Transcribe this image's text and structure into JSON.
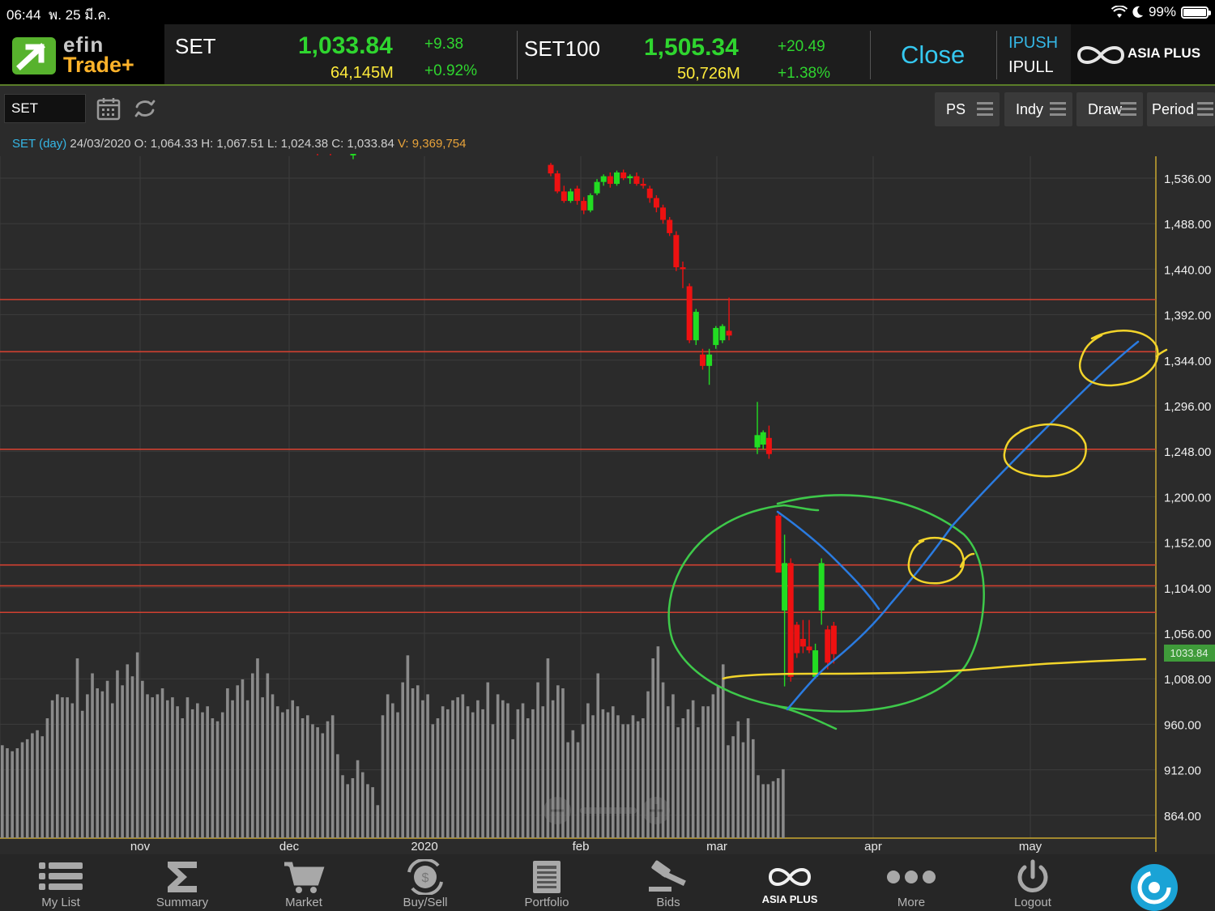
{
  "status": {
    "time": "06:44",
    "date": "พ. 25 มี.ค.",
    "battery": "99%"
  },
  "brand": {
    "line1": "efin",
    "line2": "Trade+"
  },
  "indices": [
    {
      "name": "SET",
      "value": "1,033.84",
      "change": "+9.38",
      "volume": "64,145M",
      "percent": "+0.92%"
    },
    {
      "name": "SET100",
      "value": "1,505.34",
      "change": "+20.49",
      "volume": "50,726M",
      "percent": "+1.38%"
    }
  ],
  "market_status": "Close",
  "push": "PUSH",
  "pull": "PULL",
  "broker": "ASIA PLUS",
  "toolbar": {
    "symbol": "SET",
    "buttons": [
      "PS",
      "Indy",
      "Draw",
      "Period"
    ]
  },
  "ohlc": {
    "symbol": "SET (day)",
    "date": "24/03/2020",
    "o_label": "O:",
    "o": "1,064.33",
    "h_label": "H:",
    "h": "1,067.51",
    "l_label": "L:",
    "l": "1,024.38",
    "c_label": "C:",
    "c": "1,033.84",
    "v_label": "V:",
    "v": "9,369,754"
  },
  "colors": {
    "up": "#22dd22",
    "down": "#ee1111",
    "accent": "#35c8f0",
    "volume": "#8a8a8a",
    "hline": "#d04030"
  },
  "chart_data": {
    "type": "candlestick",
    "ylim": [
      840,
      1560
    ],
    "y_ticks": [
      "1,536.00",
      "1,488.00",
      "1,440.00",
      "1,392.00",
      "1,344.00",
      "1,296.00",
      "1,248.00",
      "1,200.00",
      "1,152.00",
      "1,104.00",
      "1,056.00",
      "1,008.00",
      "960.00",
      "912.00",
      "864.00"
    ],
    "x_ticks": [
      "nov",
      "dec",
      "2020",
      "feb",
      "mar",
      "apr",
      "may"
    ],
    "last_price_label": "1033.84",
    "horizontal_levels": [
      1408,
      1353,
      1250,
      1128,
      1106,
      1078
    ],
    "candles": [
      [
        1582,
        1585,
        1566,
        1572
      ],
      [
        1570,
        1576,
        1560,
        1565
      ],
      [
        1568,
        1580,
        1564,
        1578
      ],
      [
        1575,
        1577,
        1560,
        1562
      ],
      [
        1560,
        1578,
        1556,
        1575
      ],
      [
        1575,
        1579,
        1568,
        1577
      ],
      [
        1550,
        1552,
        1538,
        1541
      ],
      [
        1541,
        1544,
        1520,
        1522
      ],
      [
        1522,
        1528,
        1510,
        1512
      ],
      [
        1512,
        1525,
        1510,
        1522
      ],
      [
        1525,
        1528,
        1508,
        1512
      ],
      [
        1512,
        1516,
        1498,
        1502
      ],
      [
        1502,
        1520,
        1500,
        1518
      ],
      [
        1520,
        1535,
        1518,
        1532
      ],
      [
        1532,
        1540,
        1528,
        1538
      ],
      [
        1538,
        1542,
        1526,
        1530
      ],
      [
        1530,
        1544,
        1528,
        1542
      ],
      [
        1542,
        1545,
        1534,
        1536
      ],
      [
        1536,
        1540,
        1530,
        1538
      ],
      [
        1538,
        1542,
        1528,
        1530
      ],
      [
        1530,
        1536,
        1525,
        1528
      ],
      [
        1525,
        1528,
        1510,
        1515
      ],
      [
        1515,
        1518,
        1500,
        1505
      ],
      [
        1505,
        1508,
        1488,
        1492
      ],
      [
        1492,
        1495,
        1475,
        1478
      ],
      [
        1476,
        1480,
        1438,
        1442
      ],
      [
        1442,
        1448,
        1420,
        1440
      ],
      [
        1422,
        1425,
        1362,
        1365
      ],
      [
        1365,
        1398,
        1360,
        1395
      ],
      [
        1350,
        1356,
        1334,
        1338
      ],
      [
        1338,
        1356,
        1318,
        1350
      ],
      [
        1360,
        1380,
        1356,
        1378
      ],
      [
        1365,
        1382,
        1362,
        1380
      ],
      [
        1375,
        1410,
        1365,
        1370
      ],
      [
        1252,
        1300,
        1245,
        1265
      ],
      [
        1255,
        1270,
        1250,
        1268
      ],
      [
        1262,
        1275,
        1240,
        1245
      ],
      [
        1180,
        1182,
        1120,
        1120
      ],
      [
        1080,
        1160,
        1000,
        1130
      ],
      [
        1130,
        1135,
        1005,
        1010
      ],
      [
        1065,
        1068,
        1030,
        1035
      ],
      [
        1050,
        1070,
        1035,
        1042
      ],
      [
        1042,
        1070,
        1035,
        1038
      ],
      [
        1010,
        1045,
        1008,
        1038
      ],
      [
        1080,
        1135,
        1065,
        1130
      ],
      [
        1060,
        1064,
        1018,
        1025
      ],
      [
        1064,
        1068,
        1024,
        1034
      ]
    ],
    "volume": [
      62,
      60,
      58,
      60,
      64,
      66,
      70,
      72,
      68,
      80,
      92,
      96,
      94,
      94,
      90,
      120,
      85,
      96,
      110,
      100,
      98,
      105,
      90,
      112,
      102,
      116,
      108,
      124,
      105,
      96,
      94,
      96,
      100,
      92,
      94,
      88,
      80,
      94,
      86,
      90,
      84,
      88,
      80,
      78,
      84,
      100,
      92,
      102,
      106,
      92,
      110,
      120,
      94,
      110,
      96,
      88,
      84,
      86,
      92,
      88,
      80,
      82,
      76,
      74,
      70,
      78,
      82,
      56,
      42,
      36,
      40,
      52,
      44,
      36,
      34,
      22,
      82,
      96,
      90,
      84,
      104,
      122,
      100,
      102,
      92,
      96,
      76,
      80,
      88,
      86,
      92,
      94,
      96,
      88,
      84,
      92,
      86,
      104,
      76,
      96,
      92,
      90,
      66,
      86,
      90,
      80,
      86,
      104,
      88,
      120,
      92,
      102,
      100,
      64,
      72,
      64,
      76,
      90,
      82,
      110,
      86,
      84,
      88,
      82,
      76,
      76,
      82,
      78,
      80,
      98,
      120,
      128,
      104,
      88,
      96,
      74,
      80,
      86,
      92,
      74,
      88,
      88,
      96,
      102,
      116,
      62,
      68,
      78,
      64,
      80,
      66,
      42,
      36,
      36,
      38,
      40,
      46
    ]
  },
  "nav": [
    {
      "label": "My List",
      "icon": "list-icon"
    },
    {
      "label": "Summary",
      "icon": "sigma-icon"
    },
    {
      "label": "Market",
      "icon": "cart-icon"
    },
    {
      "label": "Buy/Sell",
      "icon": "exchange-icon"
    },
    {
      "label": "Portfolio",
      "icon": "document-icon"
    },
    {
      "label": "Bids",
      "icon": "gavel-icon"
    },
    {
      "label": "ASIA PLUS",
      "icon": "asiaplus-logo-icon"
    },
    {
      "label": "More",
      "icon": "dots-icon"
    },
    {
      "label": "Logout",
      "icon": "power-icon"
    },
    {
      "label": "",
      "icon": "refresh-circle-icon"
    }
  ]
}
